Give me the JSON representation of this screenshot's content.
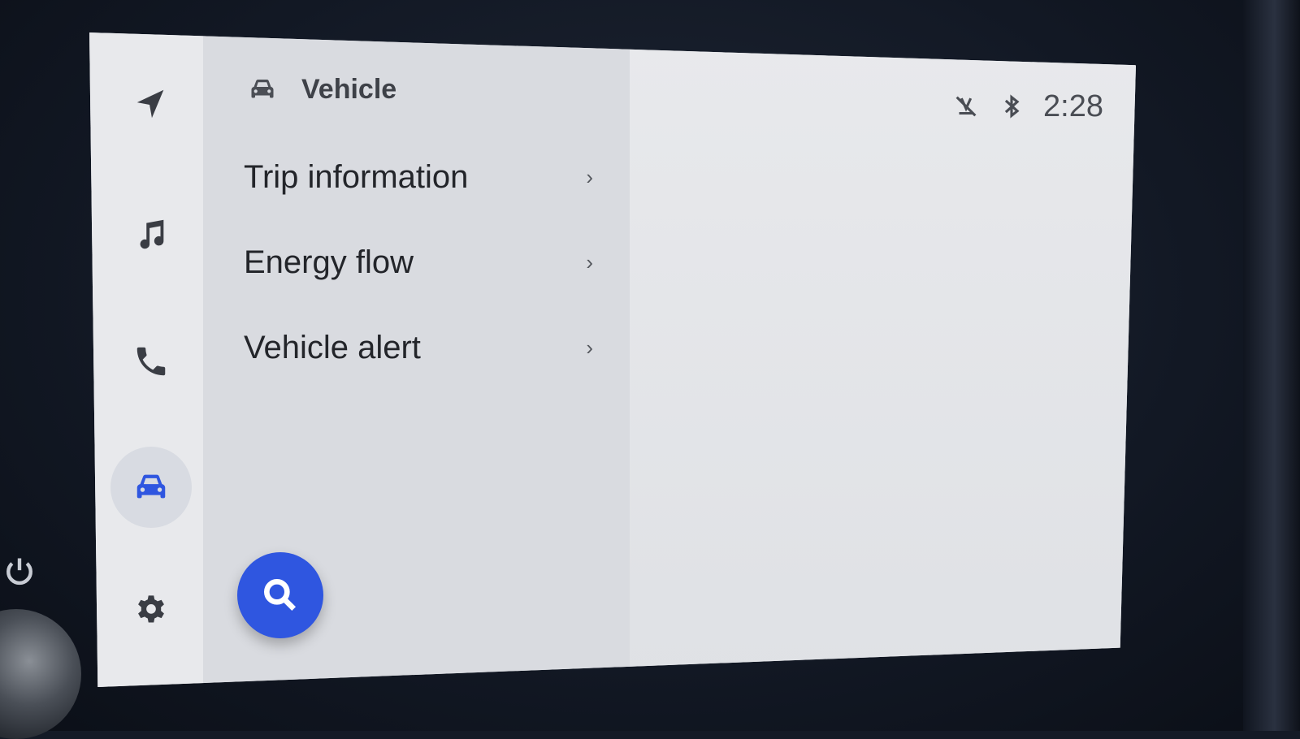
{
  "rail": {
    "items": [
      {
        "name": "navigation",
        "icon": "navigation-arrow-icon",
        "active": false
      },
      {
        "name": "music",
        "icon": "music-note-icon",
        "active": false
      },
      {
        "name": "phone",
        "icon": "phone-icon",
        "active": false
      },
      {
        "name": "vehicle",
        "icon": "car-icon",
        "active": true
      },
      {
        "name": "settings",
        "icon": "gear-icon",
        "active": false
      }
    ]
  },
  "panel": {
    "title": "Vehicle",
    "title_icon": "car-icon",
    "items": [
      {
        "label": "Trip information",
        "chevron": "›"
      },
      {
        "label": "Energy flow",
        "chevron": "›"
      },
      {
        "label": "Vehicle alert",
        "chevron": "›"
      }
    ]
  },
  "search": {
    "icon": "search-icon"
  },
  "status": {
    "icons": [
      "voice-off-icon",
      "bluetooth-icon"
    ],
    "time": "2:28"
  },
  "colors": {
    "accent": "#2f56e0",
    "screen_bg": "#e3e5e9",
    "panel_bg": "#d9dbe0"
  }
}
